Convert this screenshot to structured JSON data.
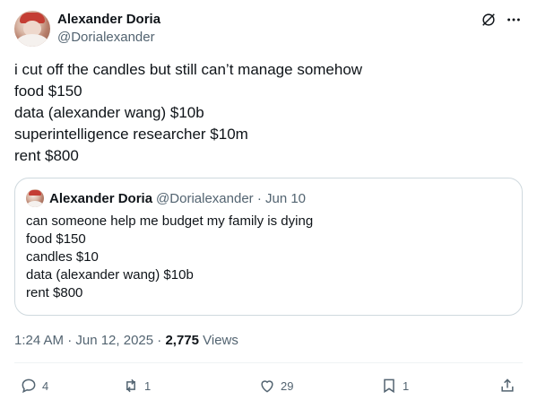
{
  "author": {
    "display_name": "Alexander Doria",
    "handle": "@Dorialexander"
  },
  "tweet": {
    "lines": [
      "i cut off the candles but still can’t manage somehow",
      "food $150",
      "data (alexander wang) $10b",
      "superintelligence researcher $10m",
      "rent $800"
    ]
  },
  "quote": {
    "display_name": "Alexander Doria",
    "meta": "@Dorialexander · Jun 10",
    "lines": [
      "can someone help me budget my family is dying",
      "food $150",
      "candles $10",
      "data (alexander wang) $10b",
      "rent $800"
    ]
  },
  "meta": {
    "timestamp": "1:24 AM · Jun 12, 2025 · ",
    "views_count": "2,775",
    "views_label": " Views"
  },
  "actions": {
    "replies": "4",
    "reposts": "1",
    "likes": "29",
    "bookmarks": "1"
  },
  "icons": {
    "grok": "grok-icon",
    "more": "more-icon",
    "reply": "reply-icon",
    "repost": "repost-icon",
    "like": "heart-icon",
    "bookmark": "bookmark-icon",
    "share": "share-icon"
  }
}
